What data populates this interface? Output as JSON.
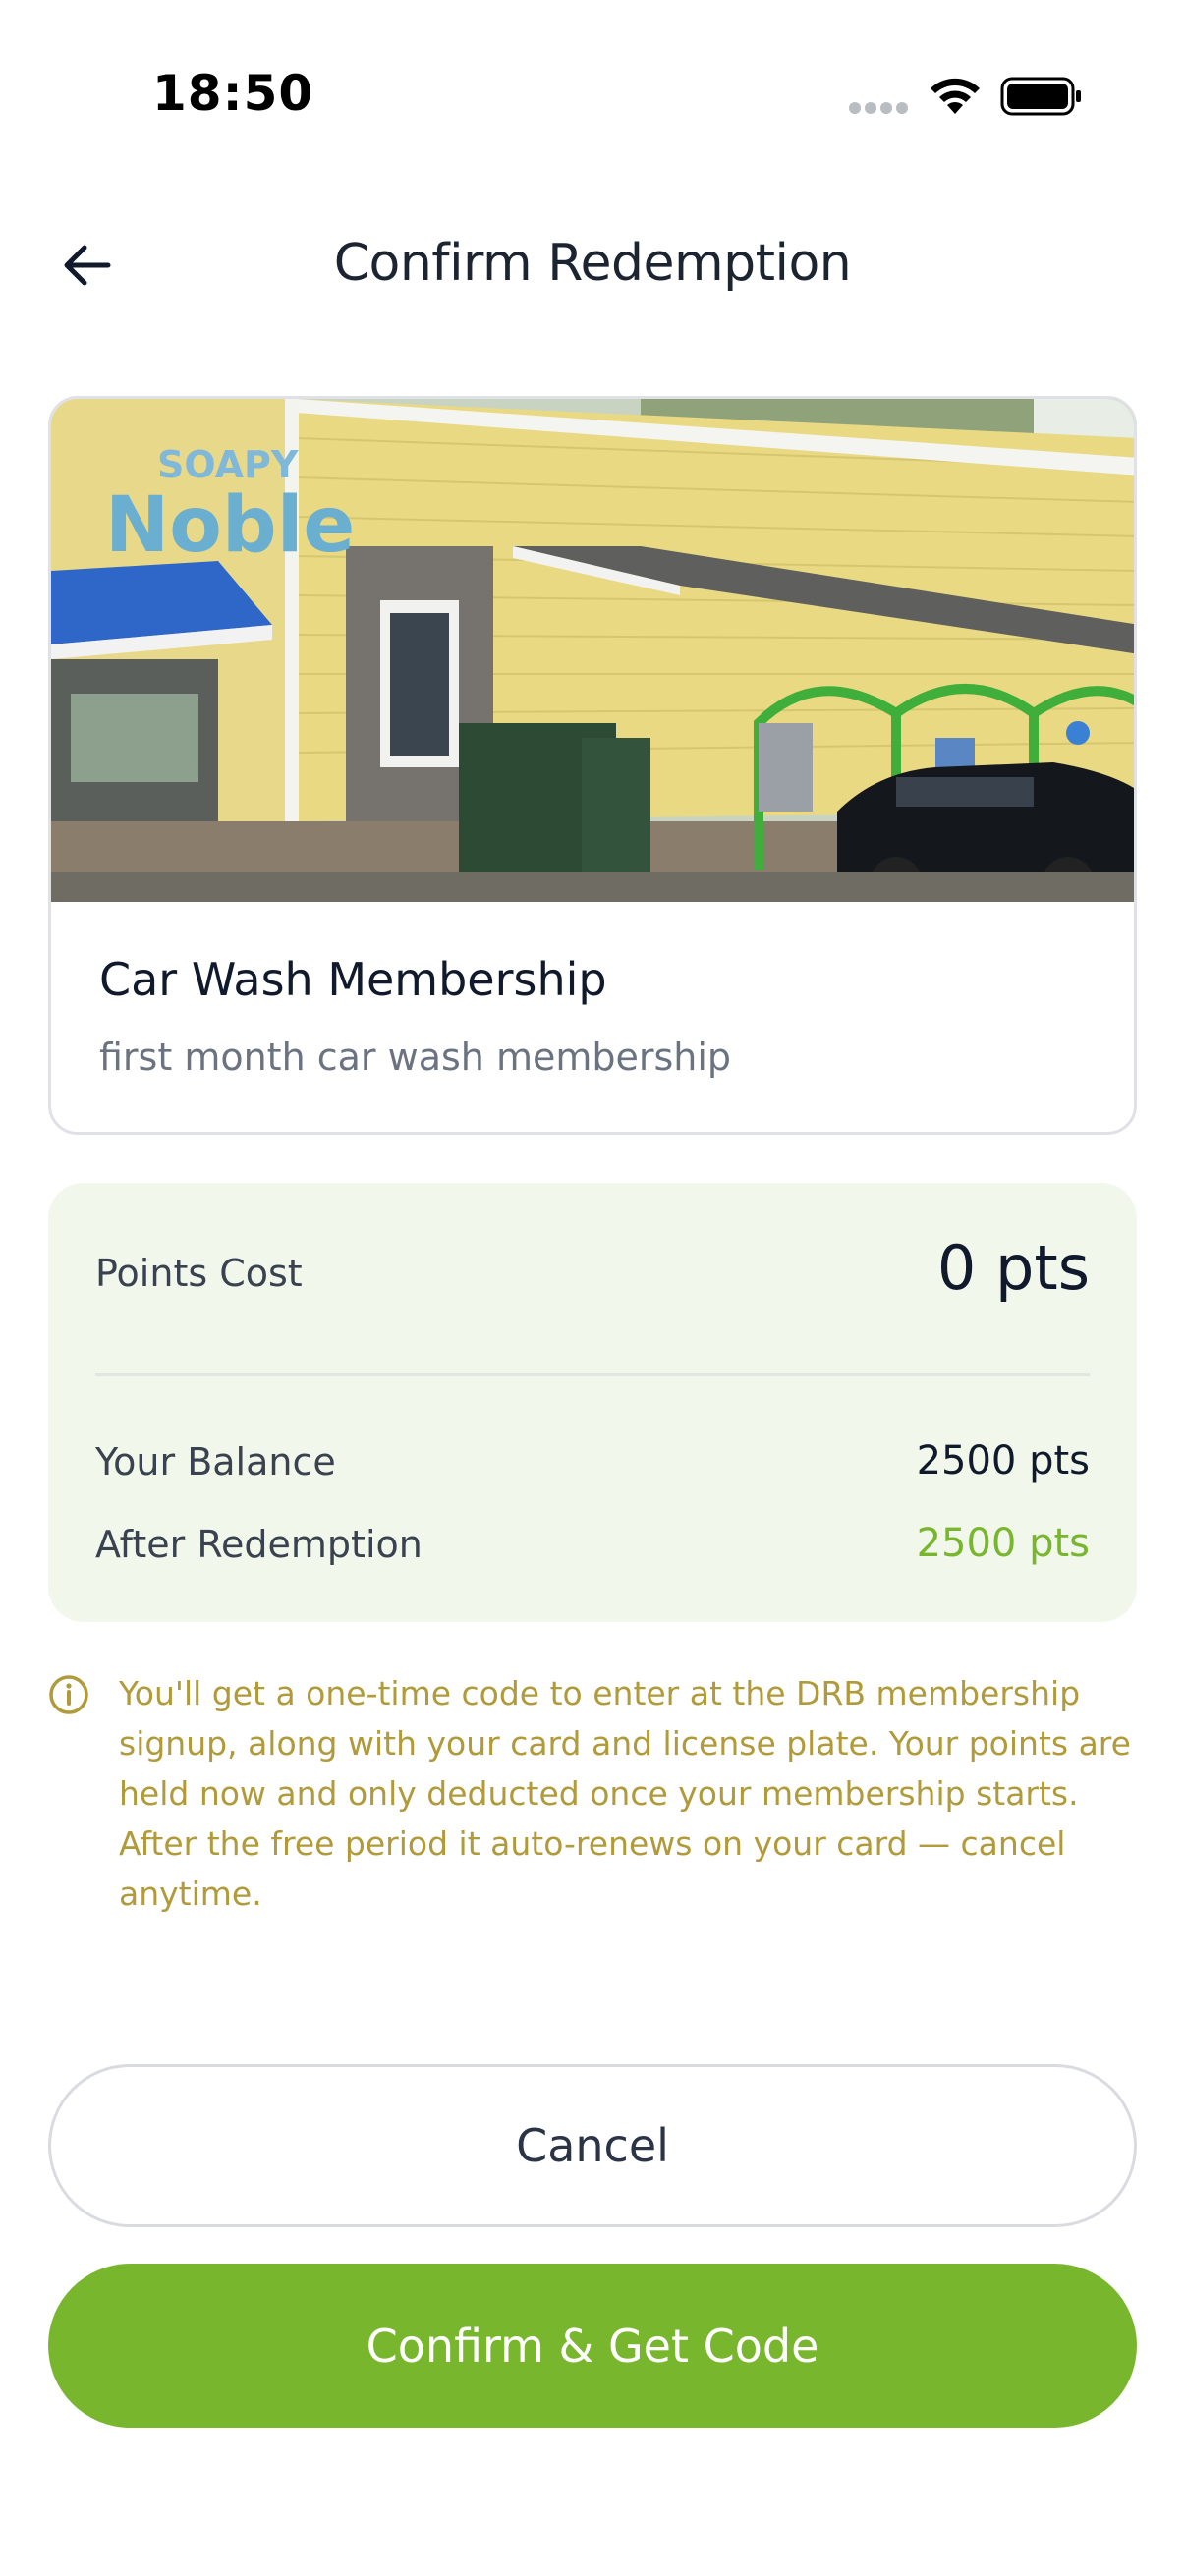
{
  "status_bar": {
    "time": "18:50"
  },
  "header": {
    "title": "Confirm Redemption",
    "back_icon": "arrow-left-icon"
  },
  "reward": {
    "image_alt": "Soapy Noble car wash building",
    "sign_text": "SOAPY Noble",
    "title": "Car Wash Membership",
    "description": "first month car wash membership"
  },
  "points": {
    "cost_label": "Points Cost",
    "cost_value": "0 pts",
    "balance_label": "Your Balance",
    "balance_value": "2500 pts",
    "after_label": "After Redemption",
    "after_value": "2500 pts"
  },
  "info": {
    "icon": "info-circle-icon",
    "text": "You'll get a one-time code to enter at the DRB membership signup, along with your card and license plate. Your points are held now and only deducted once your membership starts. After the free period it auto-renews on your card — cancel anytime."
  },
  "actions": {
    "cancel_label": "Cancel",
    "confirm_label": "Confirm & Get Code"
  },
  "colors": {
    "accent": "#78b62e",
    "points_bg": "#f2f7ec",
    "info_text": "#b09a3a"
  }
}
